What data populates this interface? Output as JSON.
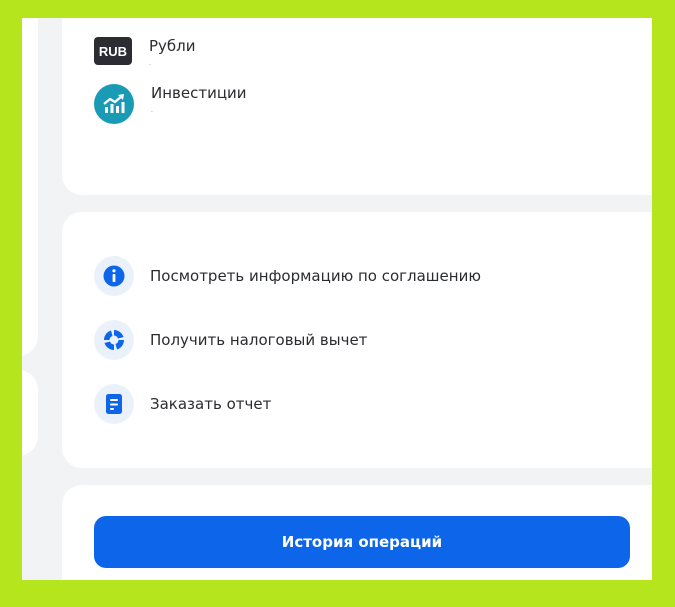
{
  "accounts": [
    {
      "badge": "RUB",
      "name": "Рубли",
      "balance": ""
    },
    {
      "icon": "investment-chart-icon",
      "name": "Инвестиции",
      "balance": ""
    }
  ],
  "actions": [
    {
      "icon": "info-icon",
      "label": "Посмотреть информацию по соглашению"
    },
    {
      "icon": "tax-deduction-icon",
      "label": "Получить налоговый вычет"
    },
    {
      "icon": "document-icon",
      "label": "Заказать отчет"
    }
  ],
  "history_button": {
    "label": "История операций"
  },
  "colors": {
    "page_border": "#b5e61d",
    "primary_blue": "#0d66ea",
    "investment_teal": "#1a9bb5",
    "rub_badge_bg": "#2b2d33",
    "icon_circle_bg": "#eaf1fb",
    "background": "#f2f3f5"
  }
}
